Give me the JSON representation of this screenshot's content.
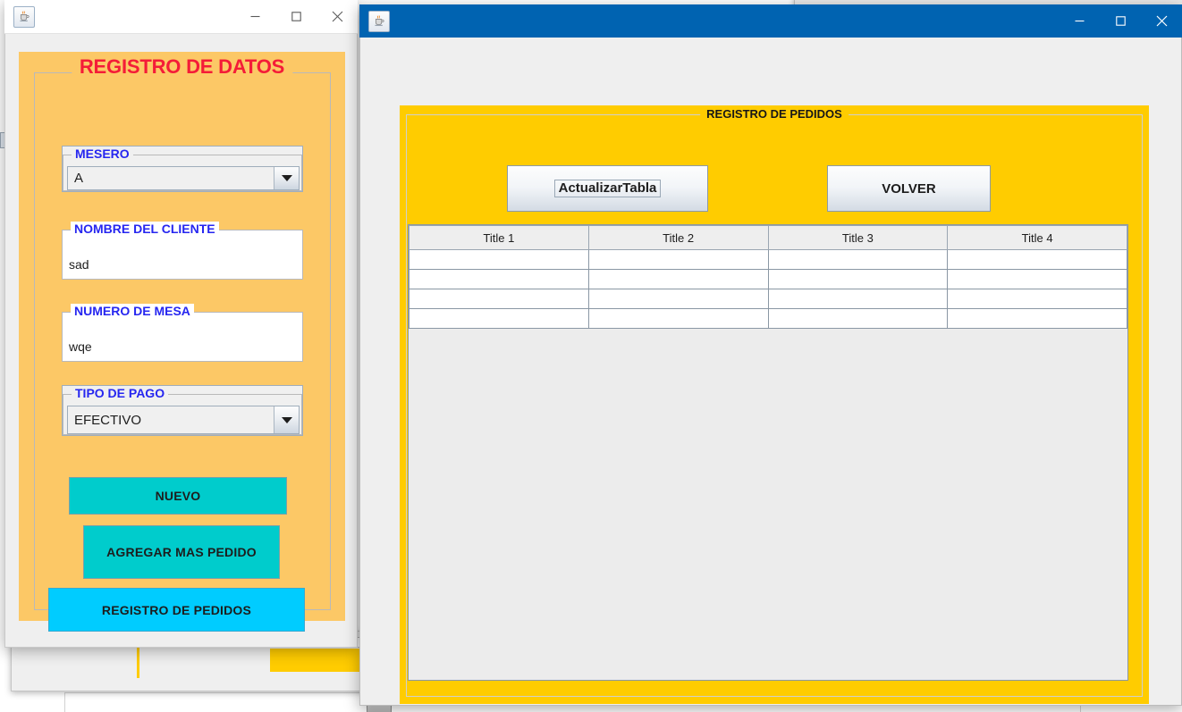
{
  "window_datos": {
    "titlebar": {
      "app_icon": "java-coffee-cup-icon",
      "minimize_label": "—",
      "maximize_label": "□",
      "close_label": "✕"
    },
    "panel_title": "REGISTRO DE DATOS",
    "fields": [
      {
        "label": "MESERO",
        "type": "combo",
        "value": "A",
        "arrow_icon": "chevron-down-icon",
        "name": "mesero"
      },
      {
        "label": "NOMBRE DEL CLIENTE",
        "type": "text",
        "value": "sad",
        "name": "nombre-del-cliente"
      },
      {
        "label": "NUMERO DE MESA",
        "type": "text",
        "value": "wqe",
        "name": "numero-de-mesa"
      },
      {
        "label": "TIPO DE PAGO",
        "type": "combo",
        "value": "EFECTIVO",
        "arrow_icon": "chevron-down-icon",
        "name": "tipo-de-pago"
      }
    ],
    "buttons": [
      {
        "label": "NUEVO",
        "color": "#00cccc",
        "name": "nuevo"
      },
      {
        "label": "AGREGAR MAS PEDIDO",
        "color": "#00cccc",
        "name": "agregar-mas-pedido"
      },
      {
        "label": "REGISTRO DE PEDIDOS",
        "color": "#00ccff",
        "name": "registro-de-pedidos"
      }
    ],
    "colors": {
      "panel_bg": "#fcc866",
      "title_text": "#f41c38",
      "label_text": "#2626f0"
    }
  },
  "window_pedidos": {
    "titlebar": {
      "app_icon": "java-coffee-cup-icon",
      "minimize_label": "—",
      "maximize_label": "□",
      "close_label": "✕"
    },
    "panel_title": "REGISTRO DE PEDIDOS",
    "buttons": [
      {
        "label": "ActualizarTabla",
        "focused": true,
        "name": "actualizar-tabla"
      },
      {
        "label": "VOLVER",
        "focused": false,
        "name": "volver"
      }
    ],
    "table": {
      "columns": [
        "Title 1",
        "Title 2",
        "Title 3",
        "Title 4"
      ],
      "rows": [
        [
          "",
          "",
          "",
          ""
        ],
        [
          "",
          "",
          "",
          ""
        ],
        [
          "",
          "",
          "",
          ""
        ],
        [
          "",
          "",
          "",
          ""
        ]
      ]
    },
    "colors": {
      "panel_bg": "#ffcc00",
      "titlebar_bg": "#0063b1"
    }
  }
}
